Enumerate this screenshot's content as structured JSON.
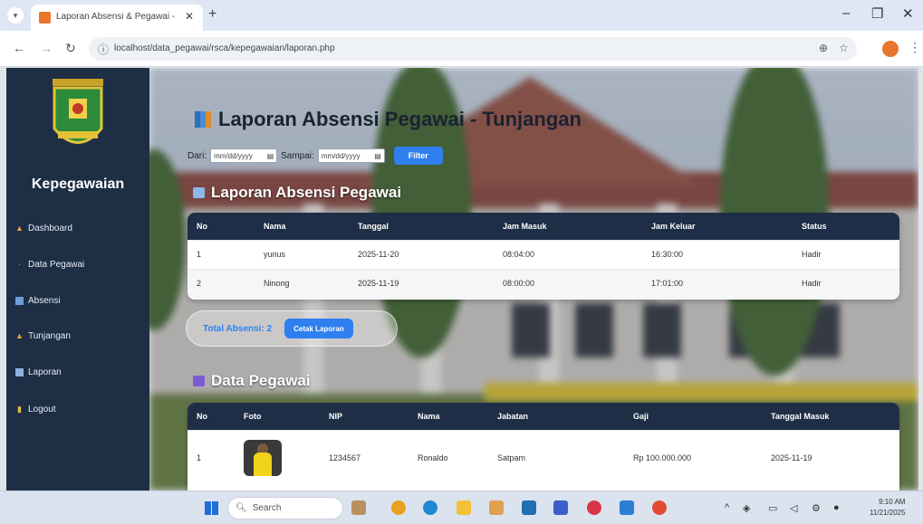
{
  "browser": {
    "tab_title": "Laporan Absensi & Pegawai - ",
    "url": "localhost/data_pegawai/rsca/kepegawaian/laporan.php"
  },
  "sidebar": {
    "brand": "Kepegawaian",
    "items": [
      {
        "label": "Dashboard",
        "icon": "home-icon"
      },
      {
        "label": "Data Pegawai",
        "icon": "users-icon"
      },
      {
        "label": "Absensi",
        "icon": "calendar-icon"
      },
      {
        "label": "Tunjangan",
        "icon": "money-icon"
      },
      {
        "label": "Laporan",
        "icon": "report-icon"
      },
      {
        "label": "Logout",
        "icon": "logout-icon"
      }
    ]
  },
  "main": {
    "title": "Laporan Absensi Pegawai - Tunjangan",
    "filter": {
      "from_label": "Dari:",
      "to_label": "Sampai:",
      "from_placeholder": "mm/dd/yyyy",
      "to_placeholder": "mm/dd/yyyy",
      "button": "Filter"
    },
    "absensi": {
      "heading": "Laporan Absensi Pegawai",
      "headers": [
        "No",
        "Nama",
        "Tanggal",
        "Jam Masuk",
        "Jam Keluar",
        "Status"
      ],
      "rows": [
        [
          "1",
          "yunus",
          "2025-11-20",
          "08:04:00",
          "16:30:00",
          "Hadir"
        ],
        [
          "2",
          "Ninong",
          "2025-11-19",
          "08:00:00",
          "17:01:00",
          "Hadir"
        ]
      ]
    },
    "summary": {
      "total_label": "Total Absensi: 2",
      "print_button": "Cetak Laporan"
    },
    "pegawai": {
      "heading": "Data Pegawai",
      "headers": [
        "No",
        "Foto",
        "NIP",
        "Nama",
        "Jabatan",
        "Gaji",
        "Tanggal Masuk"
      ],
      "rows": [
        [
          "1",
          "",
          "1234567",
          "Ronaldo",
          "Satpam",
          "Rp 100.000.000",
          "2025-11-19"
        ]
      ]
    }
  },
  "taskbar": {
    "search_placeholder": "Search",
    "time": "9:10 AM",
    "date": "11/21/2025"
  },
  "colors": {
    "sidebar_bg": "#1d2e45",
    "table_header_bg": "#1e2e46",
    "accent": "#2f7ff0"
  }
}
